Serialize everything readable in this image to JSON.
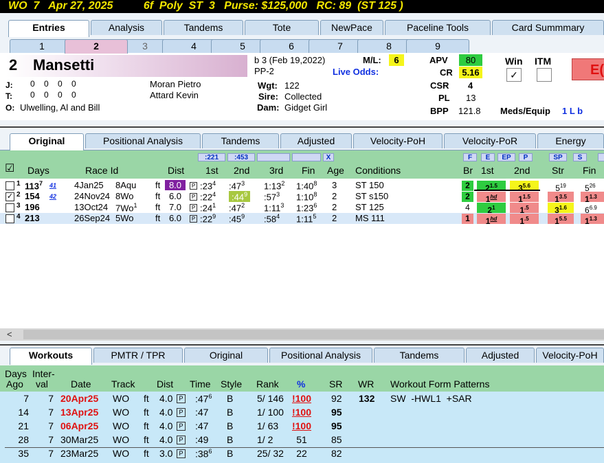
{
  "title_bar": "WO  7   Apr 27, 2025          6f  Poly  ST  3   Purse: $125,000   RC: 89  (ST 125 )",
  "main_tabs": [
    "Entries",
    "Analysis",
    "Tandems",
    "Tote",
    "NewPace",
    "Paceline Tools",
    "Card Summmary"
  ],
  "horse_tabs": [
    "1",
    "2",
    "3",
    "4",
    "5",
    "6",
    "7",
    "8",
    "9"
  ],
  "horse": {
    "number": "2",
    "name": "Mansetti",
    "j_label": "J:",
    "j_stats": "0    0    0    0",
    "jockey": "Moran Pietro",
    "t_label": "T:",
    "t_stats": "0    0    0    0",
    "trainer": "Attard Kevin",
    "o_label": "O:",
    "owner": "Ulwelling, Al and Bill",
    "breed": "b  3 (Feb 19,2022)",
    "pp": "PP-2",
    "ml_label": "M/L:",
    "ml_value": "6",
    "live_odds_label": "Live Odds:",
    "wgt_label": "Wgt:",
    "wgt": "122",
    "sire_label": "Sire:",
    "sire": "Collected",
    "dam_label": "Dam:",
    "dam": "Gidget Girl",
    "apv_label": "APV",
    "apv": "80",
    "cr_label": "CR",
    "cr": "5.16",
    "csr_label": "CSR",
    "csr": "4",
    "pl_label": "PL",
    "pl": "13",
    "bpp_label": "BPP",
    "bpp": "121.8",
    "win_label": "Win",
    "win_mark": "✓",
    "itm_label": "ITM",
    "meds_label": "Meds/Equip",
    "meds": "1 L b",
    "red_button": "E("
  },
  "past_tabs": [
    "Original",
    "Positional Analysis",
    "Tandems",
    "Adjusted",
    "Velocity-PoH",
    "Velocity-PoR",
    "Energy"
  ],
  "past_header": {
    "split1": ":221",
    "split2": ":453",
    "x_btn": "X",
    "check": "☑",
    "cols": [
      "Days",
      "Race Id",
      "Dist",
      "1st",
      "2nd",
      "3rd",
      "Fin",
      "Age",
      "Conditions"
    ],
    "fig_btns": [
      "F",
      "E",
      "EP",
      "P",
      "SP",
      "S"
    ],
    "fig_cols": [
      "Br",
      "1st",
      "2nd",
      "Str",
      "Fin"
    ]
  },
  "past_rows": [
    {
      "idx": "1",
      "checked": "",
      "days": "113",
      "sup": "7",
      "sub": "41",
      "date": "4Jan25",
      "race": "8Aqu",
      "surf": "ft",
      "dist": "8.0",
      "first": ":23",
      "first_s": "4",
      "second": ":47",
      "second_s": "3",
      "third": "1:13",
      "third_s": "2",
      "fin": "1:40",
      "fin_s": "8",
      "age": "3",
      "cond": "ST 150",
      "br": "2",
      "f1": "2",
      "f1s": "1.5",
      "f2": "3",
      "f2s": "5.6",
      "str": "5",
      "strs": "19",
      "fn": "5",
      "fns": "26"
    },
    {
      "idx": "2",
      "checked": "✓",
      "days": "154",
      "sup": "",
      "sub": "42",
      "date": "24Nov24",
      "race": "8Wo",
      "surf": "ft",
      "dist": "6.0",
      "first": ":22",
      "first_s": "4",
      "second": ":44",
      "second_s": "9",
      "third": ":57",
      "third_s": "3",
      "fin": "1:10",
      "fin_s": "8",
      "age": "2",
      "cond": "ST s150",
      "br": "2",
      "f1": "1",
      "f1s": "hd",
      "f2": "1",
      "f2s": "1.5",
      "str": "1",
      "strs": "3.5",
      "fn": "1",
      "fns": "1.3"
    },
    {
      "idx": "3",
      "checked": "",
      "days": "196",
      "sup": "",
      "sub": "",
      "date": "13Oct24",
      "race": "7Wo",
      "racesup": "1",
      "surf": "ft",
      "dist": "7.0",
      "first": ":24",
      "first_s": "1",
      "second": ":47",
      "second_s": "2",
      "third": "1:11",
      "third_s": "3",
      "fin": "1:23",
      "fin_s": "6",
      "age": "2",
      "cond": "ST 125",
      "br": "4",
      "f1": "2",
      "f1s": "1",
      "f2": "1",
      "f2s": ".5",
      "str": "3",
      "strs": "1.6",
      "fn": "6",
      "fns": "6.9"
    },
    {
      "idx": "4",
      "checked": "",
      "days": "213",
      "sup": "",
      "sub": "",
      "date": "26Sep24",
      "race": "5Wo",
      "surf": "ft",
      "dist": "6.0",
      "first": ":22",
      "first_s": "9",
      "second": ":45",
      "second_s": "9",
      "third": ":58",
      "third_s": "4",
      "fin": "1:11",
      "fin_s": "5",
      "age": "2",
      "cond": "MS 111",
      "br": "1",
      "f1": "1",
      "f1s": "hd",
      "f2": "1",
      "f2s": ".5",
      "str": "1",
      "strs": "5.5",
      "fn": "1",
      "fns": "1.3"
    }
  ],
  "scroll_left": "<",
  "work_tabs": [
    "Workouts",
    "PMTR / TPR",
    "Original",
    "Positional Analysis",
    "Tandems",
    "Adjusted",
    "Velocity-PoH"
  ],
  "work_header": {
    "days": "Days",
    "ago": "Ago",
    "inter": "Inter-",
    "val": "val",
    "date": "Date",
    "track": "Track",
    "dist": "Dist",
    "time": "Time",
    "style": "Style",
    "rank": "Rank",
    "pct": "%",
    "sr": "SR",
    "wr": "WR",
    "patterns": "Workout Form Patterns"
  },
  "work_rows": [
    {
      "ago": "7",
      "inter": "7",
      "date": "20Apr25",
      "red": true,
      "track": "WO",
      "surf": "ft",
      "dist": "4.0",
      "time": ":47",
      "ts": "6",
      "style": "B",
      "rank": "5/ 146",
      "bold": false,
      "pct": "100",
      "bang": true,
      "sr": "92",
      "wr": "132",
      "pat": "SW  -HWL1  +SAR"
    },
    {
      "ago": "14",
      "inter": "7",
      "date": "13Apr25",
      "red": true,
      "track": "WO",
      "surf": "ft",
      "dist": "4.0",
      "time": ":47",
      "ts": "",
      "style": "B",
      "rank": "1/ 100",
      "bold": true,
      "pct": "100",
      "bang": true,
      "sr": "95",
      "wr": "",
      "pat": ""
    },
    {
      "ago": "21",
      "inter": "7",
      "date": "06Apr25",
      "red": true,
      "track": "WO",
      "surf": "ft",
      "dist": "4.0",
      "time": ":47",
      "ts": "",
      "style": "B",
      "rank": "1/ 63",
      "bold": true,
      "pct": "100",
      "bang": true,
      "sr": "95",
      "wr": "",
      "pat": ""
    },
    {
      "ago": "28",
      "inter": "7",
      "date": "30Mar25",
      "red": false,
      "track": "WO",
      "surf": "ft",
      "dist": "4.0",
      "time": ":49",
      "ts": "",
      "style": "B",
      "rank": "1/ 2",
      "bold": true,
      "pct": "51",
      "bang": false,
      "sr": "85",
      "wr": "",
      "pat": ""
    },
    {
      "ago": "35",
      "inter": "7",
      "date": "23Mar25",
      "red": false,
      "track": "WO",
      "surf": "ft",
      "dist": "3.0",
      "time": ":38",
      "ts": "6",
      "style": "B",
      "rank": "25/ 32",
      "bold": false,
      "pct": "22",
      "bang": false,
      "sr": "82",
      "wr": "",
      "pat": ""
    }
  ]
}
